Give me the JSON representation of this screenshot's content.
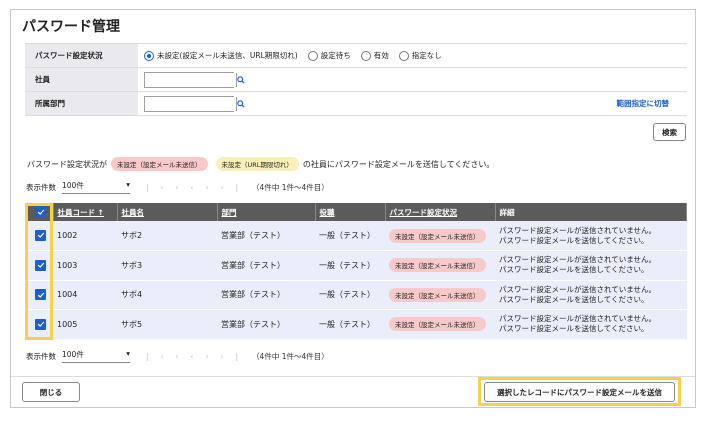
{
  "page_title": "パスワード管理",
  "form": {
    "status_label": "パスワード設定状況",
    "status_options": [
      "未設定(設定メール未送信、URL期限切れ)",
      "設定待ち",
      "有効",
      "指定なし"
    ],
    "status_selected_index": 0,
    "employee_label": "社員",
    "employee_value": "",
    "dept_label": "所属部門",
    "dept_value": "",
    "advanced_link": "範囲指定に切替"
  },
  "search_button": "検索",
  "message": {
    "prefix": "パスワード設定状況が",
    "tag1": "未設定（設定メール未送信）",
    "tag2": "未設定（URL期限切れ）",
    "suffix": "の社員にパスワード設定メールを送信してください。"
  },
  "pager": {
    "label": "表示件数",
    "per_page": "100件",
    "count": "（4件中 1件〜4件目）"
  },
  "table": {
    "headers": [
      "社員コード ↑",
      "社員名",
      "部門",
      "役職",
      "パスワード設定状況",
      "詳細"
    ],
    "rows": [
      {
        "code": "1002",
        "name": "サボ2",
        "dept": "営業部（テスト）",
        "role": "一般（テスト）",
        "status": "未設定（設定メール未送信）",
        "detail1": "パスワード設定メールが送信されていません。",
        "detail2": "パスワード設定メールを送信してください。"
      },
      {
        "code": "1003",
        "name": "サボ3",
        "dept": "営業部（テスト）",
        "role": "一般（テスト）",
        "status": "未設定（設定メール未送信）",
        "detail1": "パスワード設定メールが送信されていません。",
        "detail2": "パスワード設定メールを送信してください。"
      },
      {
        "code": "1004",
        "name": "サボ4",
        "dept": "営業部（テスト）",
        "role": "一般（テスト）",
        "status": "未設定（設定メール未送信）",
        "detail1": "パスワード設定メールが送信されていません。",
        "detail2": "パスワード設定メールを送信してください。"
      },
      {
        "code": "1005",
        "name": "サボ5",
        "dept": "営業部（テスト）",
        "role": "一般（テスト）",
        "status": "未設定（設定メール未送信）",
        "detail1": "パスワード設定メールが送信されていません。",
        "detail2": "パスワード設定メールを送信してください。"
      }
    ]
  },
  "footer": {
    "close_label": "閉じる",
    "send_label": "選択したレコードにパスワード設定メールを送信"
  },
  "colors": {
    "accent": "#1b5fd0",
    "highlight": "#f5d24a",
    "header_bg": "#5b5b5b",
    "row_bg": "#e9eefa"
  }
}
